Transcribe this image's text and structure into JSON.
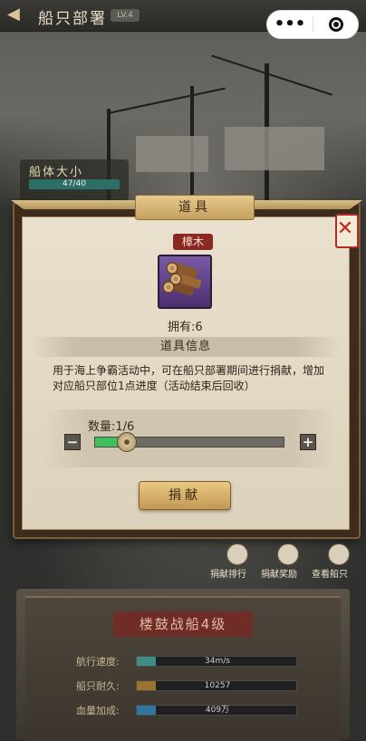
{
  "topbar": {
    "title": "船只部署",
    "mini": "LV.4"
  },
  "hull": {
    "title": "船体大小",
    "progress": "47/40"
  },
  "dialog": {
    "title": "道具",
    "item_name": "樟木",
    "owned": "拥有:6",
    "info_header": "道具信息",
    "description": "用于海上争霸活动中，可在船只部署期间进行捐献，增加对应船只部位1点进度（活动结束后回收）",
    "quantity_label": "数量:1/6",
    "quantity_fraction": 0.1667,
    "donate_label": "捐献"
  },
  "side_buttons": [
    {
      "label": "捐献排行"
    },
    {
      "label": "捐献奖励"
    },
    {
      "label": "查看船只"
    }
  ],
  "ship": {
    "title": "楼鼓战船4级",
    "stats": [
      {
        "label": "航行速度:",
        "value": "34m/s",
        "fraction": 0.12,
        "color": "#3d8d86"
      },
      {
        "label": "船只耐久:",
        "value": "10257",
        "fraction": 0.12,
        "color": "#9a7430"
      },
      {
        "label": "血量加成:",
        "value": "409万",
        "fraction": 0.12,
        "color": "#2f77a0"
      }
    ]
  }
}
